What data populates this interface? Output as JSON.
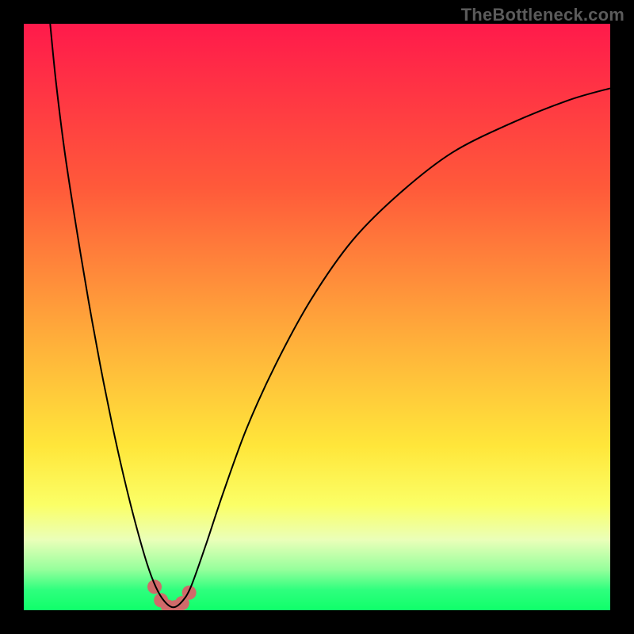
{
  "watermark": "TheBottleneck.com",
  "chart_data": {
    "type": "line",
    "title": "",
    "xlabel": "",
    "ylabel": "",
    "xlim": [
      0,
      100
    ],
    "ylim": [
      0,
      100
    ],
    "gradient_stops": [
      {
        "offset": 0,
        "color": "#ff1a4b"
      },
      {
        "offset": 0.28,
        "color": "#ff5a3a"
      },
      {
        "offset": 0.55,
        "color": "#ffb23a"
      },
      {
        "offset": 0.72,
        "color": "#ffe63a"
      },
      {
        "offset": 0.82,
        "color": "#fbff66"
      },
      {
        "offset": 0.88,
        "color": "#eaffb9"
      },
      {
        "offset": 0.93,
        "color": "#97ff9c"
      },
      {
        "offset": 0.965,
        "color": "#2fff7e"
      },
      {
        "offset": 1.0,
        "color": "#0fff6a"
      }
    ],
    "series": [
      {
        "name": "curve",
        "color": "#000000",
        "width": 2,
        "points": [
          {
            "x": 4.5,
            "y": 100
          },
          {
            "x": 5.5,
            "y": 90
          },
          {
            "x": 7.0,
            "y": 78
          },
          {
            "x": 9.0,
            "y": 65
          },
          {
            "x": 11.0,
            "y": 53
          },
          {
            "x": 13.0,
            "y": 42
          },
          {
            "x": 15.0,
            "y": 32
          },
          {
            "x": 17.0,
            "y": 23
          },
          {
            "x": 19.0,
            "y": 15
          },
          {
            "x": 21.0,
            "y": 8
          },
          {
            "x": 22.5,
            "y": 4
          },
          {
            "x": 24.0,
            "y": 1.5
          },
          {
            "x": 25.5,
            "y": 0.5
          },
          {
            "x": 27.0,
            "y": 1.5
          },
          {
            "x": 28.5,
            "y": 4
          },
          {
            "x": 31.0,
            "y": 11
          },
          {
            "x": 34.0,
            "y": 20
          },
          {
            "x": 38.0,
            "y": 31
          },
          {
            "x": 43.0,
            "y": 42
          },
          {
            "x": 49.0,
            "y": 53
          },
          {
            "x": 56.0,
            "y": 63
          },
          {
            "x": 64.0,
            "y": 71
          },
          {
            "x": 73.0,
            "y": 78
          },
          {
            "x": 83.0,
            "y": 83
          },
          {
            "x": 93.0,
            "y": 87
          },
          {
            "x": 100.0,
            "y": 89
          }
        ]
      },
      {
        "name": "bottom-dots",
        "color": "#d06a6a",
        "radius": 9,
        "points": [
          {
            "x": 22.3,
            "y": 4.0
          },
          {
            "x": 23.4,
            "y": 1.7
          },
          {
            "x": 24.6,
            "y": 0.6
          },
          {
            "x": 25.8,
            "y": 0.5
          },
          {
            "x": 27.0,
            "y": 1.2
          },
          {
            "x": 28.2,
            "y": 3.0
          }
        ]
      }
    ]
  }
}
